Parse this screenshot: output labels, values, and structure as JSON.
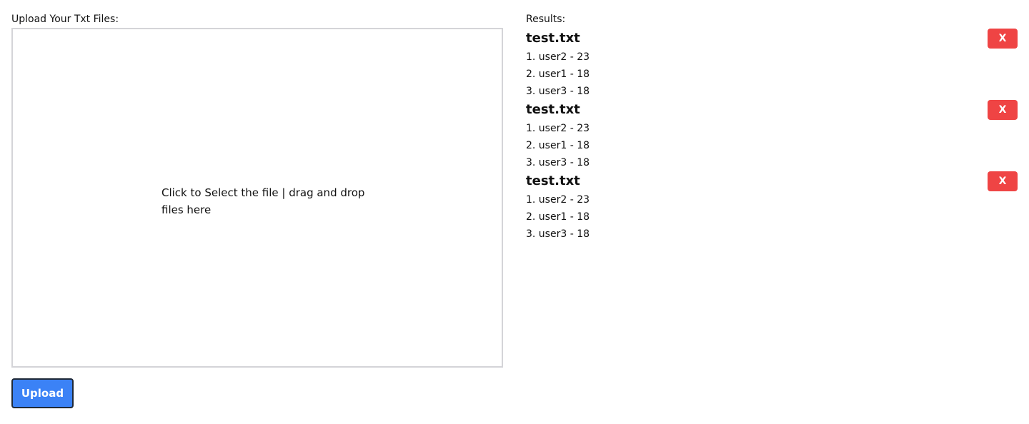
{
  "upload": {
    "label": "Upload Your Txt Files:",
    "dropzone_text": "Click to Select the file | drag and drop files here",
    "button_label": "Upload"
  },
  "results": {
    "label": "Results:",
    "remove_label": "X",
    "items": [
      {
        "filename": "test.txt",
        "lines": [
          "1. user2 - 23",
          "2. user1 - 18",
          "3. user3 - 18"
        ]
      },
      {
        "filename": "test.txt",
        "lines": [
          "1. user2 - 23",
          "2. user1 - 18",
          "3. user3 - 18"
        ]
      },
      {
        "filename": "test.txt",
        "lines": [
          "1. user2 - 23",
          "2. user1 - 18",
          "3. user3 - 18"
        ]
      }
    ]
  },
  "colors": {
    "upload_button": "#3b82f6",
    "remove_button": "#ef4444",
    "dropzone_border": "#d4d4d8"
  }
}
